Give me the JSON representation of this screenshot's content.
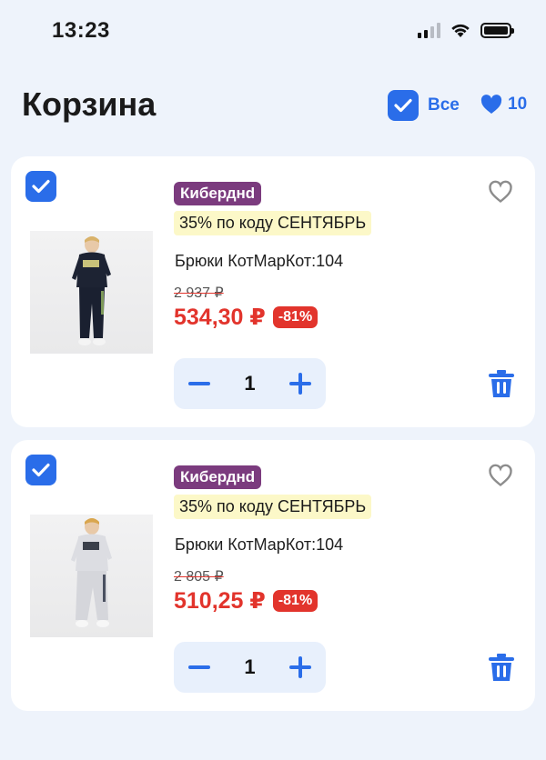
{
  "status": {
    "time": "13:23"
  },
  "header": {
    "title": "Корзина",
    "select_all_label": "Все",
    "favorites_count": "10"
  },
  "accent_color": "#2a6de9",
  "price_color": "#e2342c",
  "promo_badge_color": "#7b3b7e",
  "items": [
    {
      "promo_badge": "Киберднd",
      "promo_code": "35% по коду СЕНТЯБРЬ",
      "name": "Брюки КотМарКот:104",
      "old_price": "2 937 ₽",
      "new_price": "534,30 ₽",
      "discount": "-81%",
      "quantity": "1",
      "image_icon": "product-photo-dark-suit"
    },
    {
      "promo_badge": "Киберднd",
      "promo_code": "35% по коду СЕНТЯБРЬ",
      "name": "Брюки КотМарКот:104",
      "old_price": "2 805 ₽",
      "new_price": "510,25 ₽",
      "discount": "-81%",
      "quantity": "1",
      "image_icon": "product-photo-light-suit"
    }
  ]
}
